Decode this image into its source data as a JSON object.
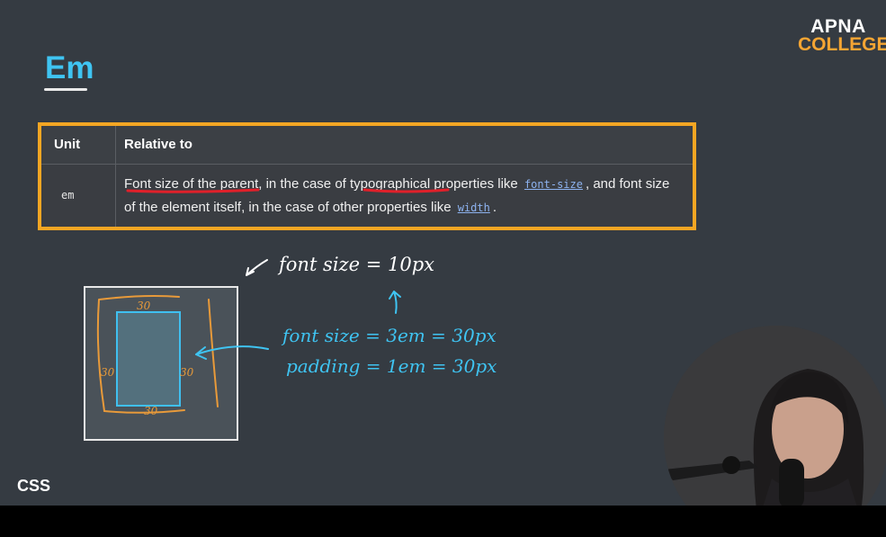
{
  "slide": {
    "title": "Em",
    "logo": {
      "line1": "APNA",
      "line2": "COLLEGE"
    },
    "corner_label": "CSS"
  },
  "table": {
    "headers": [
      "Unit",
      "Relative to"
    ],
    "row": {
      "unit": "em",
      "rel_part1": "Font size of the parent",
      "rel_part2": ", in the case of ",
      "rel_part3": "typographical",
      "rel_part4": " properties like ",
      "rel_code1": "font-size",
      "rel_part5": ", and font size of the element itself, in the case of other properties like ",
      "rel_code2": "width",
      "rel_part6": "."
    }
  },
  "annotations": {
    "font_size_parent": "font size = 10px",
    "font_size_child": "font size = 3em = 30px",
    "padding": "padding = 1em = 30px",
    "pad_top": "30",
    "pad_left": "30",
    "pad_right": "30",
    "pad_bottom": "30"
  },
  "colors": {
    "accent_blue": "#3fc4f2",
    "table_border": "#f5a623",
    "annotation_orange": "#e89a3a",
    "annotation_red": "#e0202a"
  }
}
